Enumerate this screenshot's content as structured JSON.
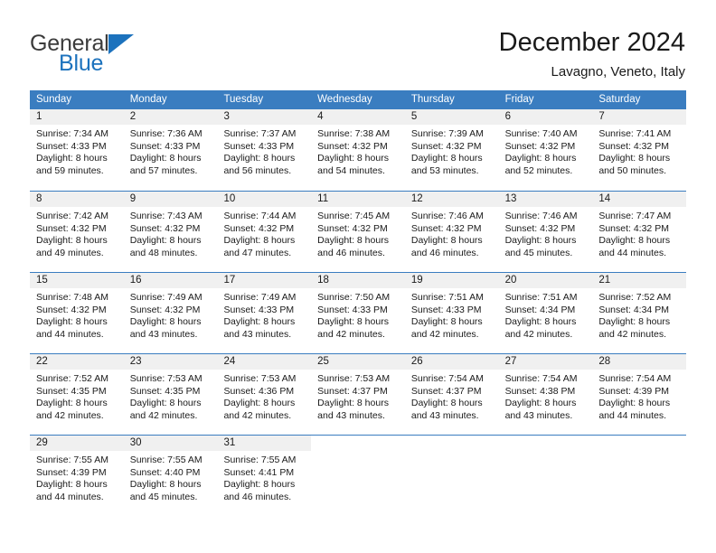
{
  "brand": {
    "name_part1": "General",
    "name_part2": "Blue",
    "accent_color": "#1c72bd"
  },
  "header": {
    "title": "December 2024",
    "subtitle": "Lavagno, Veneto, Italy"
  },
  "theme": {
    "header_bar_color": "#3a7dc0",
    "day_band_color": "#f0f0f0",
    "text_color": "#1a1a1a"
  },
  "weekdays": [
    "Sunday",
    "Monday",
    "Tuesday",
    "Wednesday",
    "Thursday",
    "Friday",
    "Saturday"
  ],
  "weeks": [
    [
      {
        "day": "1",
        "sunrise": "Sunrise: 7:34 AM",
        "sunset": "Sunset: 4:33 PM",
        "daylight1": "Daylight: 8 hours",
        "daylight2": "and 59 minutes."
      },
      {
        "day": "2",
        "sunrise": "Sunrise: 7:36 AM",
        "sunset": "Sunset: 4:33 PM",
        "daylight1": "Daylight: 8 hours",
        "daylight2": "and 57 minutes."
      },
      {
        "day": "3",
        "sunrise": "Sunrise: 7:37 AM",
        "sunset": "Sunset: 4:33 PM",
        "daylight1": "Daylight: 8 hours",
        "daylight2": "and 56 minutes."
      },
      {
        "day": "4",
        "sunrise": "Sunrise: 7:38 AM",
        "sunset": "Sunset: 4:32 PM",
        "daylight1": "Daylight: 8 hours",
        "daylight2": "and 54 minutes."
      },
      {
        "day": "5",
        "sunrise": "Sunrise: 7:39 AM",
        "sunset": "Sunset: 4:32 PM",
        "daylight1": "Daylight: 8 hours",
        "daylight2": "and 53 minutes."
      },
      {
        "day": "6",
        "sunrise": "Sunrise: 7:40 AM",
        "sunset": "Sunset: 4:32 PM",
        "daylight1": "Daylight: 8 hours",
        "daylight2": "and 52 minutes."
      },
      {
        "day": "7",
        "sunrise": "Sunrise: 7:41 AM",
        "sunset": "Sunset: 4:32 PM",
        "daylight1": "Daylight: 8 hours",
        "daylight2": "and 50 minutes."
      }
    ],
    [
      {
        "day": "8",
        "sunrise": "Sunrise: 7:42 AM",
        "sunset": "Sunset: 4:32 PM",
        "daylight1": "Daylight: 8 hours",
        "daylight2": "and 49 minutes."
      },
      {
        "day": "9",
        "sunrise": "Sunrise: 7:43 AM",
        "sunset": "Sunset: 4:32 PM",
        "daylight1": "Daylight: 8 hours",
        "daylight2": "and 48 minutes."
      },
      {
        "day": "10",
        "sunrise": "Sunrise: 7:44 AM",
        "sunset": "Sunset: 4:32 PM",
        "daylight1": "Daylight: 8 hours",
        "daylight2": "and 47 minutes."
      },
      {
        "day": "11",
        "sunrise": "Sunrise: 7:45 AM",
        "sunset": "Sunset: 4:32 PM",
        "daylight1": "Daylight: 8 hours",
        "daylight2": "and 46 minutes."
      },
      {
        "day": "12",
        "sunrise": "Sunrise: 7:46 AM",
        "sunset": "Sunset: 4:32 PM",
        "daylight1": "Daylight: 8 hours",
        "daylight2": "and 46 minutes."
      },
      {
        "day": "13",
        "sunrise": "Sunrise: 7:46 AM",
        "sunset": "Sunset: 4:32 PM",
        "daylight1": "Daylight: 8 hours",
        "daylight2": "and 45 minutes."
      },
      {
        "day": "14",
        "sunrise": "Sunrise: 7:47 AM",
        "sunset": "Sunset: 4:32 PM",
        "daylight1": "Daylight: 8 hours",
        "daylight2": "and 44 minutes."
      }
    ],
    [
      {
        "day": "15",
        "sunrise": "Sunrise: 7:48 AM",
        "sunset": "Sunset: 4:32 PM",
        "daylight1": "Daylight: 8 hours",
        "daylight2": "and 44 minutes."
      },
      {
        "day": "16",
        "sunrise": "Sunrise: 7:49 AM",
        "sunset": "Sunset: 4:32 PM",
        "daylight1": "Daylight: 8 hours",
        "daylight2": "and 43 minutes."
      },
      {
        "day": "17",
        "sunrise": "Sunrise: 7:49 AM",
        "sunset": "Sunset: 4:33 PM",
        "daylight1": "Daylight: 8 hours",
        "daylight2": "and 43 minutes."
      },
      {
        "day": "18",
        "sunrise": "Sunrise: 7:50 AM",
        "sunset": "Sunset: 4:33 PM",
        "daylight1": "Daylight: 8 hours",
        "daylight2": "and 42 minutes."
      },
      {
        "day": "19",
        "sunrise": "Sunrise: 7:51 AM",
        "sunset": "Sunset: 4:33 PM",
        "daylight1": "Daylight: 8 hours",
        "daylight2": "and 42 minutes."
      },
      {
        "day": "20",
        "sunrise": "Sunrise: 7:51 AM",
        "sunset": "Sunset: 4:34 PM",
        "daylight1": "Daylight: 8 hours",
        "daylight2": "and 42 minutes."
      },
      {
        "day": "21",
        "sunrise": "Sunrise: 7:52 AM",
        "sunset": "Sunset: 4:34 PM",
        "daylight1": "Daylight: 8 hours",
        "daylight2": "and 42 minutes."
      }
    ],
    [
      {
        "day": "22",
        "sunrise": "Sunrise: 7:52 AM",
        "sunset": "Sunset: 4:35 PM",
        "daylight1": "Daylight: 8 hours",
        "daylight2": "and 42 minutes."
      },
      {
        "day": "23",
        "sunrise": "Sunrise: 7:53 AM",
        "sunset": "Sunset: 4:35 PM",
        "daylight1": "Daylight: 8 hours",
        "daylight2": "and 42 minutes."
      },
      {
        "day": "24",
        "sunrise": "Sunrise: 7:53 AM",
        "sunset": "Sunset: 4:36 PM",
        "daylight1": "Daylight: 8 hours",
        "daylight2": "and 42 minutes."
      },
      {
        "day": "25",
        "sunrise": "Sunrise: 7:53 AM",
        "sunset": "Sunset: 4:37 PM",
        "daylight1": "Daylight: 8 hours",
        "daylight2": "and 43 minutes."
      },
      {
        "day": "26",
        "sunrise": "Sunrise: 7:54 AM",
        "sunset": "Sunset: 4:37 PM",
        "daylight1": "Daylight: 8 hours",
        "daylight2": "and 43 minutes."
      },
      {
        "day": "27",
        "sunrise": "Sunrise: 7:54 AM",
        "sunset": "Sunset: 4:38 PM",
        "daylight1": "Daylight: 8 hours",
        "daylight2": "and 43 minutes."
      },
      {
        "day": "28",
        "sunrise": "Sunrise: 7:54 AM",
        "sunset": "Sunset: 4:39 PM",
        "daylight1": "Daylight: 8 hours",
        "daylight2": "and 44 minutes."
      }
    ],
    [
      {
        "day": "29",
        "sunrise": "Sunrise: 7:55 AM",
        "sunset": "Sunset: 4:39 PM",
        "daylight1": "Daylight: 8 hours",
        "daylight2": "and 44 minutes."
      },
      {
        "day": "30",
        "sunrise": "Sunrise: 7:55 AM",
        "sunset": "Sunset: 4:40 PM",
        "daylight1": "Daylight: 8 hours",
        "daylight2": "and 45 minutes."
      },
      {
        "day": "31",
        "sunrise": "Sunrise: 7:55 AM",
        "sunset": "Sunset: 4:41 PM",
        "daylight1": "Daylight: 8 hours",
        "daylight2": "and 46 minutes."
      },
      {
        "day": "",
        "sunrise": "",
        "sunset": "",
        "daylight1": "",
        "daylight2": ""
      },
      {
        "day": "",
        "sunrise": "",
        "sunset": "",
        "daylight1": "",
        "daylight2": ""
      },
      {
        "day": "",
        "sunrise": "",
        "sunset": "",
        "daylight1": "",
        "daylight2": ""
      },
      {
        "day": "",
        "sunrise": "",
        "sunset": "",
        "daylight1": "",
        "daylight2": ""
      }
    ]
  ]
}
